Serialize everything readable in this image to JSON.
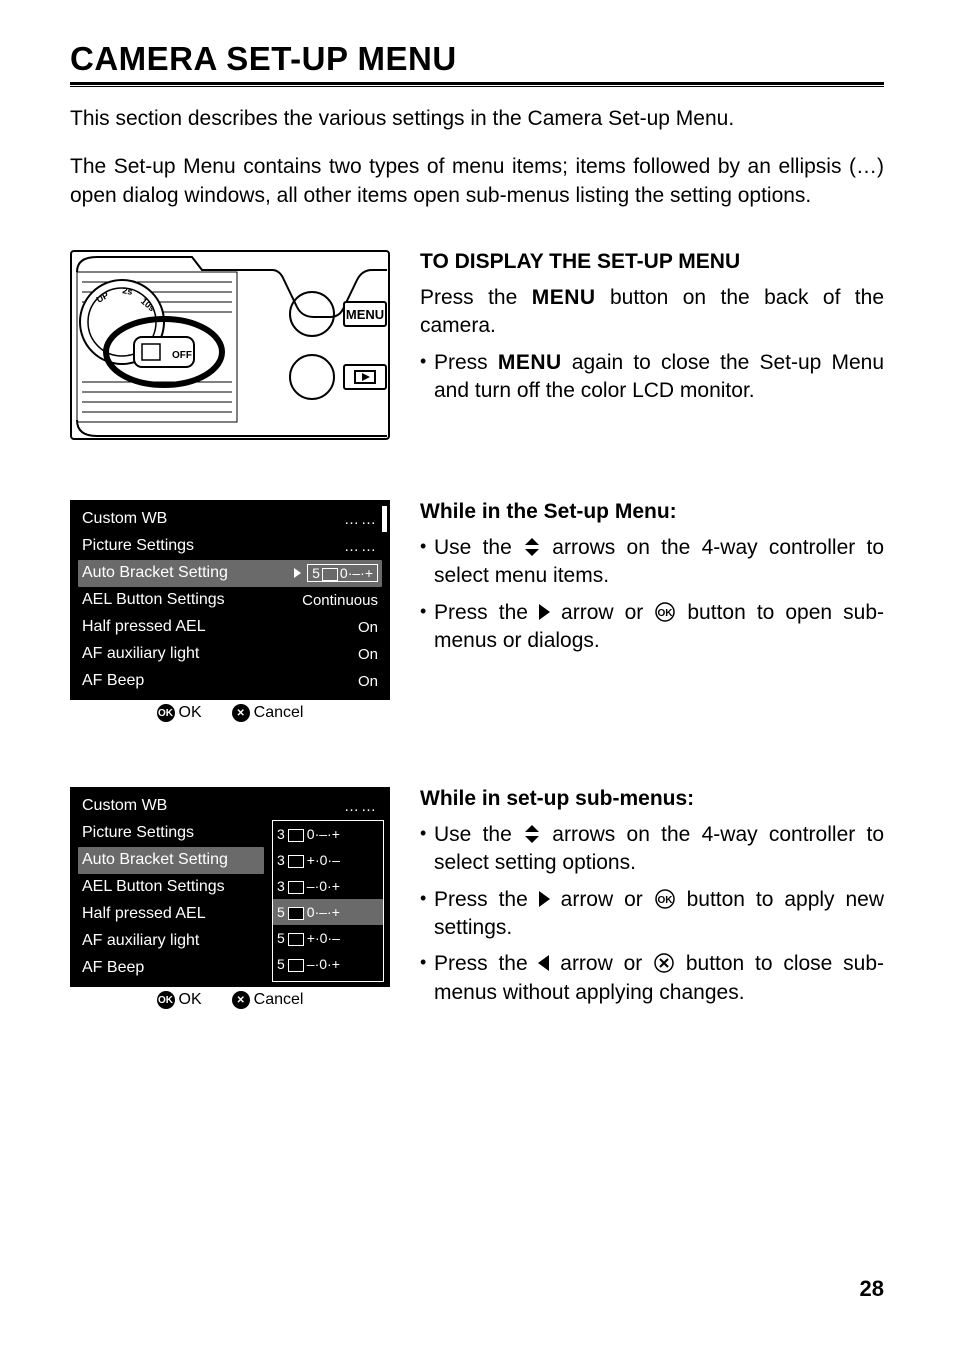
{
  "title": "CAMERA SET-UP MENU",
  "intro_p1": "This section describes the various settings in the Camera Set-up Menu.",
  "intro_p2": "The Set-up Menu contains two types of menu items; items followed by an ellipsis (…) open dialog windows, all other items open sub-menus listing the setting options.",
  "page_number": "28",
  "diagram": {
    "button_menu": "MENU",
    "button_play": "▶"
  },
  "section1": {
    "heading": "TO DISPLAY THE SET-UP MENU",
    "body": "Press the ",
    "body2": " button on the back of the camera.",
    "bullet1a": "Press ",
    "bullet1b": " again to close the Set-up Menu and turn off the color LCD monitor.",
    "menu_glyph": "MENU"
  },
  "section2": {
    "heading": "While in the Set-up Menu:",
    "bullet1a": "Use the ",
    "bullet1b": " arrows on the 4-way controller to select menu items.",
    "bullet2a": "Press the ",
    "bullet2b": " arrow or ",
    "bullet2c": " button to open sub-menus or dialogs."
  },
  "section3": {
    "heading": "While in set-up sub-menus:",
    "bullet1a": "Use the ",
    "bullet1b": " arrows on the 4-way controller to select setting options.",
    "bullet2a": "Press the ",
    "bullet2b": " arrow or ",
    "bullet2c": " button to apply new settings.",
    "bullet3a": "Press the ",
    "bullet3b": " arrow or ",
    "bullet3c": " button to close sub-menus without applying changes."
  },
  "lcd1": {
    "rows": [
      {
        "label": "Custom WB",
        "value": "……"
      },
      {
        "label": "Picture Settings",
        "value": "……"
      },
      {
        "label": "Auto Bracket Setting",
        "value": "5 0·–·+",
        "highlight": true,
        "arrow": true,
        "box": true
      },
      {
        "label": "AEL Button Settings",
        "value": "Continuous"
      },
      {
        "label": "Half pressed AEL",
        "value": "On"
      },
      {
        "label": "AF auxiliary light",
        "value": "On"
      },
      {
        "label": "AF Beep",
        "value": "On"
      }
    ],
    "footer_ok": "OK",
    "footer_cancel": "Cancel"
  },
  "lcd2": {
    "labels": [
      "Custom WB",
      "Picture Settings",
      "Auto Bracket Setting",
      "AEL Button Settings",
      "Half pressed AEL",
      "AF auxiliary light",
      "AF Beep"
    ],
    "top_value": "……",
    "options": [
      {
        "num": "3",
        "seq": "0·–·+"
      },
      {
        "num": "3",
        "seq": "+·0·–"
      },
      {
        "num": "3",
        "seq": "–·0·+"
      },
      {
        "num": "5",
        "seq": "0·–·+",
        "highlight": true
      },
      {
        "num": "5",
        "seq": "+·0·–"
      },
      {
        "num": "5",
        "seq": "–·0·+"
      }
    ],
    "footer_ok": "OK",
    "footer_cancel": "Cancel"
  }
}
